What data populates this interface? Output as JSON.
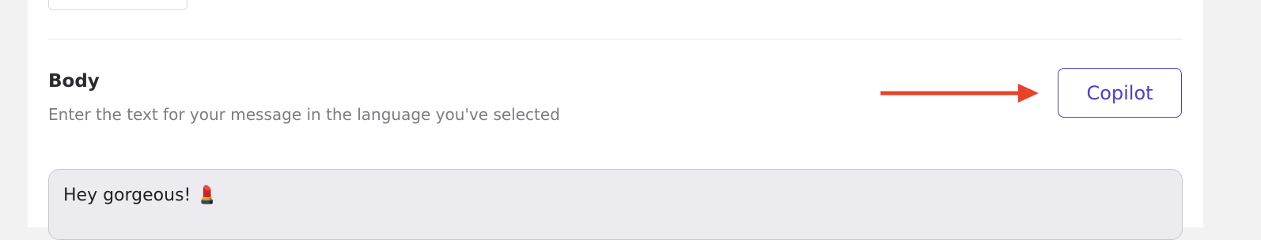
{
  "section": {
    "title": "Body",
    "description": "Enter the text for your message in the language you've selected"
  },
  "copilot_button": {
    "label": "Copilot"
  },
  "editor": {
    "value": "Hey gorgeous! 💄"
  },
  "colors": {
    "accent": "#4a3fd1",
    "arrow": "#e8432a",
    "editor_bg": "#ebebf0"
  }
}
